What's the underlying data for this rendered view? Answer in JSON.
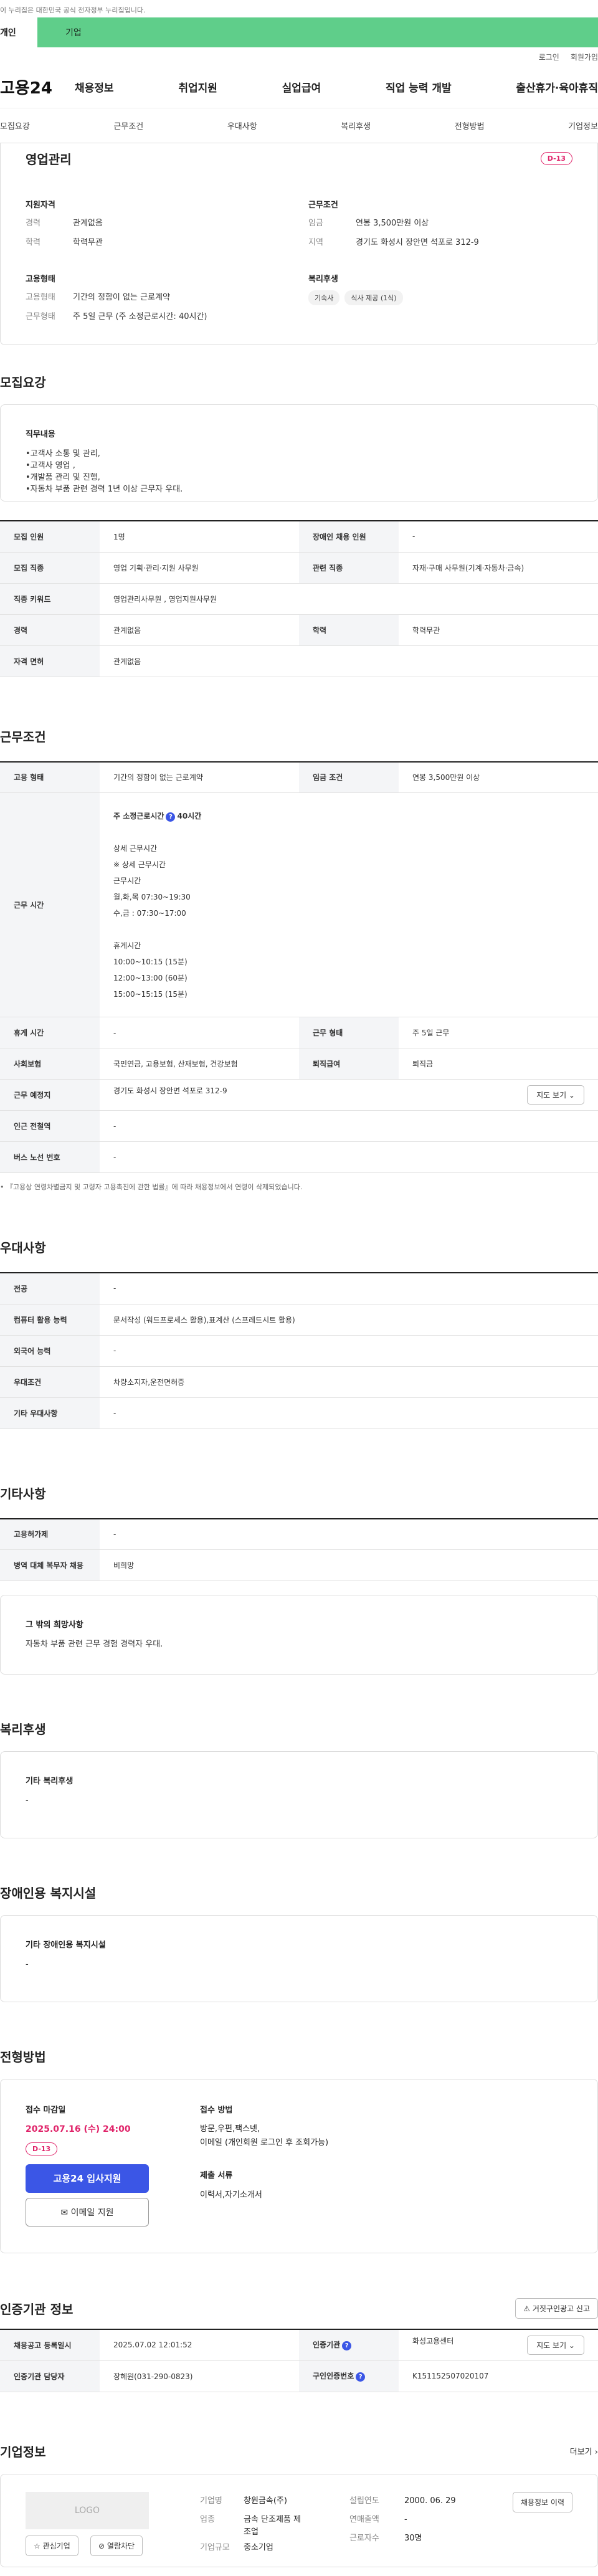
{
  "topbar": {
    "notice": "이 누리집은 대한민국 공식 전자정부 누리집입니다.",
    "tab_personal": "개인",
    "tab_company": "기업"
  },
  "util": {
    "login": "로그인",
    "signup": "회원가입"
  },
  "gnb": {
    "logo": "고용24",
    "menu": [
      "채용정보",
      "취업지원",
      "실업급여",
      "직업 능력 개발",
      "출산휴가·육아휴직"
    ]
  },
  "lnb": [
    "모집요강",
    "근무조건",
    "우대사항",
    "복리후생",
    "전형방법",
    "기업정보"
  ],
  "job": {
    "title": "영업관리",
    "dday": "D-13",
    "qual_title": "지원자격",
    "career_k": "경력",
    "career_v": "관계없음",
    "edu_k": "학력",
    "edu_v": "학력무관",
    "cond_title": "근무조건",
    "wage_k": "임금",
    "wage_v": "연봉 3,500만원 이상",
    "region_k": "지역",
    "region_v": "경기도 화성시 장안면 석포로 312-9",
    "emp_title": "고용형태",
    "emptype_k": "고용형태",
    "emptype_v": "기간의 정함이 없는 근로계약",
    "worktype_k": "근무형태",
    "worktype_v": "주 5일 근무 (주 소정근로시간: 40시간)",
    "welfare_title": "복리후생",
    "chips": [
      "기숙사",
      "식사 제공 (1식)"
    ]
  },
  "recruit": {
    "title": "모집요강",
    "duty_title": "직무내용",
    "duty_lines": [
      "•고객사 소통 및 관리,",
      "•고객사 영업 ,",
      "•개발품 관리 및 진행,",
      "•자동차 부품 관련 경력 1년 이상 근무자 우대."
    ],
    "rows": [
      {
        "k1": "모집 인원",
        "v1": "1명",
        "k2": "장애인 채용 인원",
        "v2": "-"
      },
      {
        "k1": "모집 직종",
        "v1": "영업 기획·관리·지원 사무원",
        "k2": "관련 직종",
        "v2": "자재·구매 사무원(기계·자동차·금속)"
      },
      {
        "k1": "직종 키워드",
        "v1": "영업관리사무원 , 영업지원사무원"
      },
      {
        "k1": "경력",
        "v1": "관계없음",
        "k2": "학력",
        "v2": "학력무관"
      },
      {
        "k1": "자격 면허",
        "v1": "관계없음"
      }
    ]
  },
  "work": {
    "title": "근무조건",
    "emptype_k": "고용 형태",
    "emptype_v": "기간의 정함이 없는 근로계약",
    "wage_k": "임금 조건",
    "wage_v": "연봉 3,500만원 이상",
    "time_k": "근무 시간",
    "time_head": "주 소정근로시간",
    "time_q": "?",
    "time_hours": "40시간",
    "time_lines": [
      "상세 근무시간",
      "※ 상세 근무시간",
      "근무시간",
      "월,화,목 07:30~19:30",
      "수,금 : 07:30~17:00",
      "",
      "휴게시간",
      "10:00~10:15 (15분)",
      "12:00~13:00 (60분)",
      "15:00~15:15 (15분)"
    ],
    "rest_k": "휴게 시간",
    "rest_v": "-",
    "shift_k": "근무 형태",
    "shift_v": "주 5일 근무",
    "ins_k": "사회보험",
    "ins_v": "국민연금, 고용보험, 산재보험, 건강보험",
    "ret_k": "퇴직급여",
    "ret_v": "퇴직금",
    "loc_k": "근무 예정지",
    "loc_v": "경기도 화성시 장안면 석포로 312-9",
    "map_btn": "지도 보기 ⌄",
    "sub_k": "인근 전철역",
    "sub_v": "-",
    "bus_k": "버스 노선 번호",
    "bus_v": "-",
    "note": "• 『고용상 연령차별금지 및 고령자 고용촉진에 관한 법률』에 따라 채용정보에서 연령이 삭제되었습니다."
  },
  "pref": {
    "title": "우대사항",
    "rows": [
      {
        "k": "전공",
        "v": "-"
      },
      {
        "k": "컴퓨터 활용 능력",
        "v": "문서작성 (워드프로세스 활용),표계산 (스프레드시트 활용)"
      },
      {
        "k": "외국어 능력",
        "v": "-"
      },
      {
        "k": "우대조건",
        "v": "차량소지자,운전면허증"
      },
      {
        "k": "기타 우대사항",
        "v": "-"
      }
    ]
  },
  "etc": {
    "title": "기타사항",
    "hire_k": "고용허가제",
    "hire_v": "-",
    "mil_k": "병역 대체 복무자 채용",
    "mil_v": "비희망",
    "hope_title": "그 밖의 희망사항",
    "hope_v": "자동차 부품 관련 근무 경험 경력자 우대."
  },
  "welfare": {
    "title": "복리후생",
    "box_title": "기타 복리후생",
    "box_v": "-"
  },
  "disabled": {
    "title": "장애인용 복지시설",
    "box_title": "기타 장애인용 복지시설",
    "box_v": "-"
  },
  "selection": {
    "title": "전형방법",
    "deadline_title": "접수 마감일",
    "deadline": "2025.07.16 (수) 24:00",
    "dday": "D-13",
    "btn_apply": "고용24 입사지원",
    "btn_email": "이메일 지원",
    "method_title": "접수 방법",
    "method_lines": [
      "방문,우편,팩스넷,",
      "이메일 (개인회원 로그인 후 조회가능)"
    ],
    "docs_title": "제출 서류",
    "docs_v": "이력서,자기소개서"
  },
  "cert": {
    "title": "인증기관 정보",
    "report_btn": "거짓구인광고 신고",
    "reg_k": "채용공고 등록일시",
    "reg_v": "2025.07.02 12:01:52",
    "org_k": "인증기관",
    "org_v": "화성고용센터",
    "map_btn": "지도 보기 ⌄",
    "mgr_k": "인증기관 담당자",
    "mgr_v": "장혜원(031-290-0823)",
    "num_k": "구인인증번호",
    "num_v": "K151152507020107"
  },
  "company": {
    "title": "기업정보",
    "more": "더보기 ›",
    "logo": "LOGO",
    "fav_btn": "☆ 관심기업",
    "block_btn": "⊘ 열람차단",
    "name_k": "기업명",
    "name_v": "창원금속(주)",
    "ind_k": "업종",
    "ind_v1": "금속 단조제품 제",
    "ind_v2": "조업",
    "size_k": "기업규모",
    "size_v": "중소기업",
    "est_k": "설립연도",
    "est_v": "2000. 06. 29",
    "sales_k": "연매출액",
    "sales_v": "-",
    "emp_k": "근로자수",
    "emp_v": "30명",
    "jobs_btn": "채용정보 이력"
  }
}
